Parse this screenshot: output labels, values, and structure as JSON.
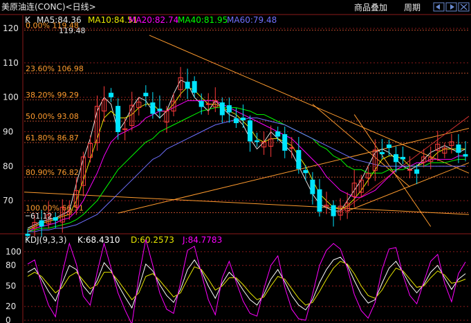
{
  "colors": {
    "background": "#000000",
    "grid": "#8b1a1a",
    "up": "#ff3b3b",
    "down": "#00e5ff",
    "fib_text": "#ff9b2e",
    "fib_line": "#b84a2a",
    "trend": "#ff9b2e",
    "ma5": "#e6e6e6",
    "ma10": "#e8e800",
    "ma20": "#ff00ff",
    "ma40": "#00ff00",
    "ma60": "#7070ff",
    "kdj_k": "#ffffff",
    "kdj_d": "#e8e800",
    "kdj_j": "#ff00ff"
  },
  "header": {
    "title": "美原油连(CONC)<日线>",
    "overlay_button": "商品叠加",
    "period_button": "周期",
    "nav_prev_icon": "arrow-left-icon",
    "nav_next_icon": "arrow-right-icon",
    "nav_close_icon": "close-icon"
  },
  "main": {
    "indicator_name": "K",
    "ma": [
      {
        "label": "MA5:84.36"
      },
      {
        "label": "MA10:84.51"
      },
      {
        "label": "MA20:82.74"
      },
      {
        "label": "MA40:81.95"
      },
      {
        "label": "MA60:79.48"
      }
    ],
    "max_label": "119.48",
    "min_label": "61.12"
  },
  "kdj": {
    "name": "KDJ(9,3,3)",
    "k_label": "K:68.4310",
    "d_label": "D:60.2573",
    "j_label": "J:84.7783"
  },
  "chart_data": [
    {
      "type": "candlestick",
      "ylim": [
        61,
        121
      ],
      "y_ticks": [
        70,
        80,
        90,
        100,
        110,
        120
      ],
      "fibonacci": [
        {
          "label": "0.00% 119.48",
          "value": 119.48
        },
        {
          "label": "23.60% 106.98",
          "value": 106.98
        },
        {
          "label": "38.20% 99.29",
          "value": 99.29
        },
        {
          "label": "50.00% 93.08",
          "value": 93.08
        },
        {
          "label": "61.80% 86.87",
          "value": 86.87
        },
        {
          "label": "80.90% 76.82",
          "value": 76.82
        },
        {
          "label": "100.00% 66.51",
          "value": 66.51
        }
      ],
      "series": [
        {
          "values": [
            62,
            63,
            64,
            64.5,
            65,
            66,
            67,
            75,
            82,
            88,
            96,
            100,
            98,
            90,
            93,
            97,
            100,
            99,
            96,
            94,
            96,
            101,
            105,
            104,
            100,
            98,
            96,
            99,
            97,
            95,
            94,
            92,
            88,
            85,
            87,
            90,
            88,
            86,
            84,
            80,
            76,
            72,
            69,
            68,
            67,
            67,
            70,
            73,
            76,
            80,
            84,
            85,
            84,
            82,
            80,
            79,
            80,
            82,
            84,
            85,
            86,
            85,
            84,
            85
          ]
        },
        {
          "values": [
            61.5,
            62.5,
            63.5,
            64,
            64.6,
            65.5,
            66,
            70,
            76,
            82,
            88,
            94,
            96,
            94,
            94,
            95,
            97,
            98,
            98,
            96,
            96,
            98,
            101,
            103,
            102,
            100,
            98,
            98,
            97,
            96,
            95,
            93,
            91,
            88,
            87,
            88,
            88,
            87,
            86,
            83,
            80,
            76,
            72,
            70,
            68,
            67.5,
            68.5,
            70.5,
            73,
            76,
            79,
            82,
            83,
            83,
            82,
            80,
            80,
            81,
            82,
            84,
            85,
            85,
            85,
            85
          ]
        },
        {
          "values": [
            61,
            62,
            62.5,
            63,
            63.5,
            64.5,
            65,
            67,
            70,
            74,
            78,
            83,
            87,
            89,
            90,
            91,
            92,
            94,
            95,
            96,
            96,
            97,
            98,
            99,
            99,
            99,
            99,
            99,
            98,
            97,
            96,
            95,
            94,
            93,
            92,
            91,
            90,
            89,
            88,
            86,
            84,
            82,
            80,
            77,
            75,
            73,
            72,
            71,
            71,
            72,
            73,
            75,
            77,
            79,
            80,
            80,
            81,
            81,
            82,
            82,
            82,
            82,
            83,
            83
          ]
        },
        {
          "values": [
            61,
            61.5,
            62,
            62,
            62.5,
            63,
            63.5,
            64.5,
            66,
            68,
            70,
            73,
            76,
            79,
            81,
            83,
            85,
            87,
            88,
            90,
            91,
            92,
            93,
            94,
            95,
            96,
            96.5,
            97,
            97,
            97,
            97,
            96.5,
            96,
            95,
            95,
            94,
            93,
            92,
            91,
            90,
            89,
            88,
            86,
            85,
            83,
            82,
            80,
            79,
            79,
            78,
            78,
            78,
            79,
            79,
            79,
            80,
            80,
            80,
            81,
            81,
            81,
            81.5,
            82,
            82
          ]
        },
        {
          "values": [
            61,
            61,
            61.5,
            61.5,
            62,
            62,
            62.5,
            63,
            64,
            65,
            66,
            68,
            70,
            72,
            74,
            76,
            78,
            80,
            82,
            83,
            85,
            86,
            87,
            88,
            89,
            90,
            91,
            92,
            92.5,
            93,
            93.5,
            93.5,
            94,
            94,
            93.5,
            93,
            92.5,
            92,
            91,
            90,
            89,
            88,
            87,
            86,
            85,
            84,
            83,
            82,
            81.5,
            81,
            80.5,
            80,
            80,
            80,
            80,
            80,
            80,
            80,
            80,
            80,
            80,
            80,
            80,
            80
          ]
        }
      ]
    },
    {
      "type": "line",
      "ylim": [
        0,
        108
      ],
      "y_ticks": [
        0,
        20,
        50,
        80,
        100
      ],
      "series": [
        {
          "values": [
            70,
            76,
            60,
            42,
            28,
            55,
            80,
            74,
            50,
            38,
            58,
            84,
            72,
            52,
            34,
            18,
            48,
            82,
            72,
            52,
            36,
            26,
            45,
            74,
            88,
            72,
            50,
            32,
            54,
            70,
            60,
            44,
            30,
            22,
            38,
            60,
            74,
            56,
            36,
            22,
            15,
            30,
            55,
            74,
            88,
            92,
            80,
            58,
            38,
            25,
            30,
            54,
            76,
            86,
            70,
            52,
            40,
            52,
            70,
            80,
            62,
            45,
            60,
            68
          ]
        },
        {
          "values": [
            64,
            70,
            64,
            52,
            40,
            48,
            64,
            70,
            58,
            46,
            52,
            70,
            70,
            58,
            44,
            30,
            40,
            64,
            68,
            58,
            46,
            34,
            40,
            60,
            78,
            74,
            60,
            44,
            50,
            62,
            62,
            52,
            40,
            30,
            34,
            50,
            64,
            60,
            46,
            32,
            22,
            26,
            42,
            60,
            76,
            86,
            82,
            68,
            50,
            36,
            32,
            44,
            62,
            76,
            72,
            60,
            48,
            50,
            62,
            72,
            66,
            54,
            56,
            60
          ]
        },
        {
          "values": [
            82,
            88,
            52,
            22,
            5,
            70,
            112,
            82,
            35,
            22,
            70,
            112,
            76,
            40,
            15,
            -6,
            64,
            118,
            80,
            40,
            16,
            10,
            55,
            102,
            108,
            68,
            30,
            8,
            62,
            86,
            56,
            28,
            10,
            6,
            46,
            80,
            94,
            48,
            16,
            2,
            0,
            38,
            80,
            102,
            112,
            104,
            76,
            38,
            14,
            3,
            26,
            74,
            104,
            106,
            66,
            36,
            24,
            56,
            86,
            96,
            54,
            27,
            68,
            85
          ]
        }
      ]
    }
  ]
}
